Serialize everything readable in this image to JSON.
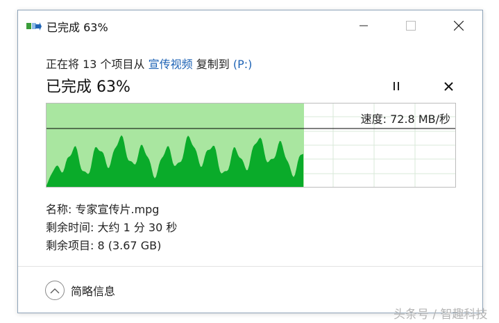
{
  "window": {
    "title": "已完成 63%",
    "icons": {
      "app": "copy-files-icon",
      "minimize": "minimize-icon",
      "maximize": "maximize-icon",
      "close": "close-icon"
    }
  },
  "header": {
    "prefix": "正在将 13 个项目从 ",
    "source": "宣传视频",
    "middle": " 复制到 ",
    "destination": "(P:)"
  },
  "progress": {
    "status": "已完成 63%",
    "percent": 63,
    "pause_icon": "pause-icon",
    "cancel_icon": "cancel-icon"
  },
  "graph": {
    "speed_text": "速度: 72.8 MB/秒",
    "fill_color": "#a9e6a0",
    "area_color": "#0aab2a",
    "grid_color": "#d8e8d8",
    "line_color": "#000000"
  },
  "details": {
    "name": "名称: 专家宣传片.mpg",
    "time_left": "剩余时间: 大约 1 分 30 秒",
    "items_left": "剩余项目: 8 (3.67 GB)"
  },
  "footer": {
    "toggle_label": "简略信息",
    "toggle_icon": "chevron-up-icon"
  },
  "watermark": "头条号 / 智趣科技"
}
